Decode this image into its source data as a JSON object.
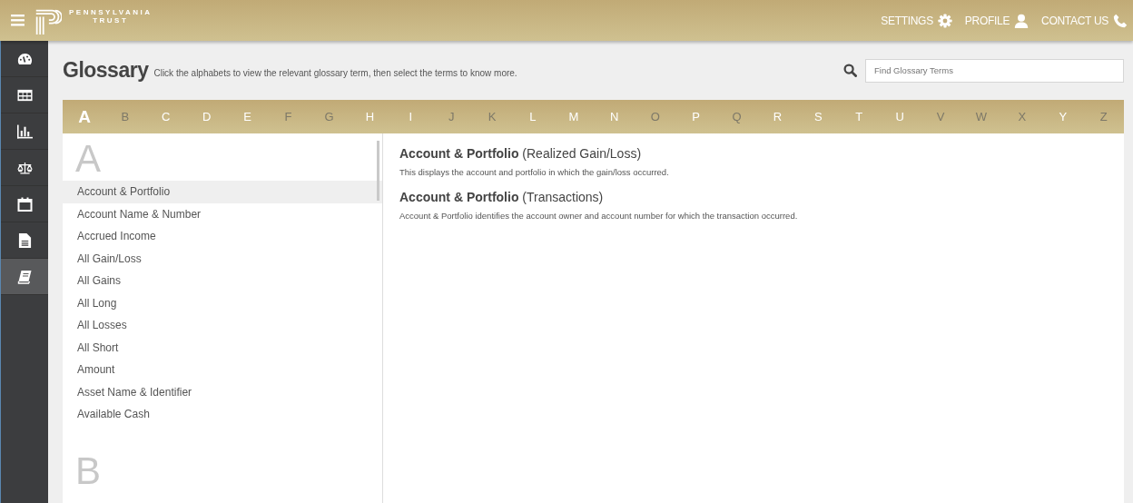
{
  "header": {
    "logo_line_1": "PENNSYLVANIA",
    "logo_line_2": "TRUST",
    "nav": [
      {
        "label": "SETTINGS",
        "kind": "settings"
      },
      {
        "label": "PROFILE",
        "kind": "profile"
      },
      {
        "label": "CONTACT US",
        "kind": "contact"
      }
    ]
  },
  "sidebar": {
    "items": [
      {
        "kind": "dashboard",
        "selected": false
      },
      {
        "kind": "table",
        "selected": false
      },
      {
        "kind": "chart",
        "selected": false
      },
      {
        "kind": "scale",
        "selected": false
      },
      {
        "kind": "calendar",
        "selected": false
      },
      {
        "kind": "document",
        "selected": false
      },
      {
        "kind": "book",
        "selected": true
      }
    ]
  },
  "page": {
    "title": "Glossary",
    "subtitle": "Click the alphabets to view the relevant glossary term, then select the terms to know more.",
    "search": {
      "placeholder": "Find Glossary Terms"
    }
  },
  "letters": [
    {
      "label": "A",
      "selected": true,
      "disabled": false
    },
    {
      "label": "B",
      "selected": false,
      "disabled": true
    },
    {
      "label": "C",
      "selected": false,
      "disabled": false
    },
    {
      "label": "D",
      "selected": false,
      "disabled": false
    },
    {
      "label": "E",
      "selected": false,
      "disabled": false
    },
    {
      "label": "F",
      "selected": false,
      "disabled": true
    },
    {
      "label": "G",
      "selected": false,
      "disabled": true
    },
    {
      "label": "H",
      "selected": false,
      "disabled": false
    },
    {
      "label": "I",
      "selected": false,
      "disabled": false
    },
    {
      "label": "J",
      "selected": false,
      "disabled": true
    },
    {
      "label": "K",
      "selected": false,
      "disabled": true
    },
    {
      "label": "L",
      "selected": false,
      "disabled": false
    },
    {
      "label": "M",
      "selected": false,
      "disabled": false
    },
    {
      "label": "N",
      "selected": false,
      "disabled": false
    },
    {
      "label": "O",
      "selected": false,
      "disabled": true
    },
    {
      "label": "P",
      "selected": false,
      "disabled": false
    },
    {
      "label": "Q",
      "selected": false,
      "disabled": true
    },
    {
      "label": "R",
      "selected": false,
      "disabled": false
    },
    {
      "label": "S",
      "selected": false,
      "disabled": false
    },
    {
      "label": "T",
      "selected": false,
      "disabled": false
    },
    {
      "label": "U",
      "selected": false,
      "disabled": false
    },
    {
      "label": "V",
      "selected": false,
      "disabled": true
    },
    {
      "label": "W",
      "selected": false,
      "disabled": true
    },
    {
      "label": "X",
      "selected": false,
      "disabled": true
    },
    {
      "label": "Y",
      "selected": false,
      "disabled": false
    },
    {
      "label": "Z",
      "selected": false,
      "disabled": true
    }
  ],
  "term_groups": [
    {
      "letter": "A",
      "terms": [
        {
          "label": "Account & Portfolio",
          "selected": true
        },
        {
          "label": "Account Name & Number",
          "selected": false
        },
        {
          "label": "Accrued Income",
          "selected": false
        },
        {
          "label": "All Gain/Loss",
          "selected": false
        },
        {
          "label": "All Gains",
          "selected": false
        },
        {
          "label": "All Long",
          "selected": false
        },
        {
          "label": "All Losses",
          "selected": false
        },
        {
          "label": "All Short",
          "selected": false
        },
        {
          "label": "Amount",
          "selected": false
        },
        {
          "label": "Asset Name & Identifier",
          "selected": false
        },
        {
          "label": "Available Cash",
          "selected": false
        }
      ]
    },
    {
      "letter": "B"
    }
  ],
  "definitions": [
    {
      "heading": "**Account & Portfolio** (Realized Gain/Loss)",
      "text": "This displays the account and portfolio in which the gain/loss occurred."
    },
    {
      "heading": "**Account & Portfolio** (Transactions)",
      "text": "Account & Portfolio identifies the account owner and account number for which the transaction occurred."
    }
  ]
}
